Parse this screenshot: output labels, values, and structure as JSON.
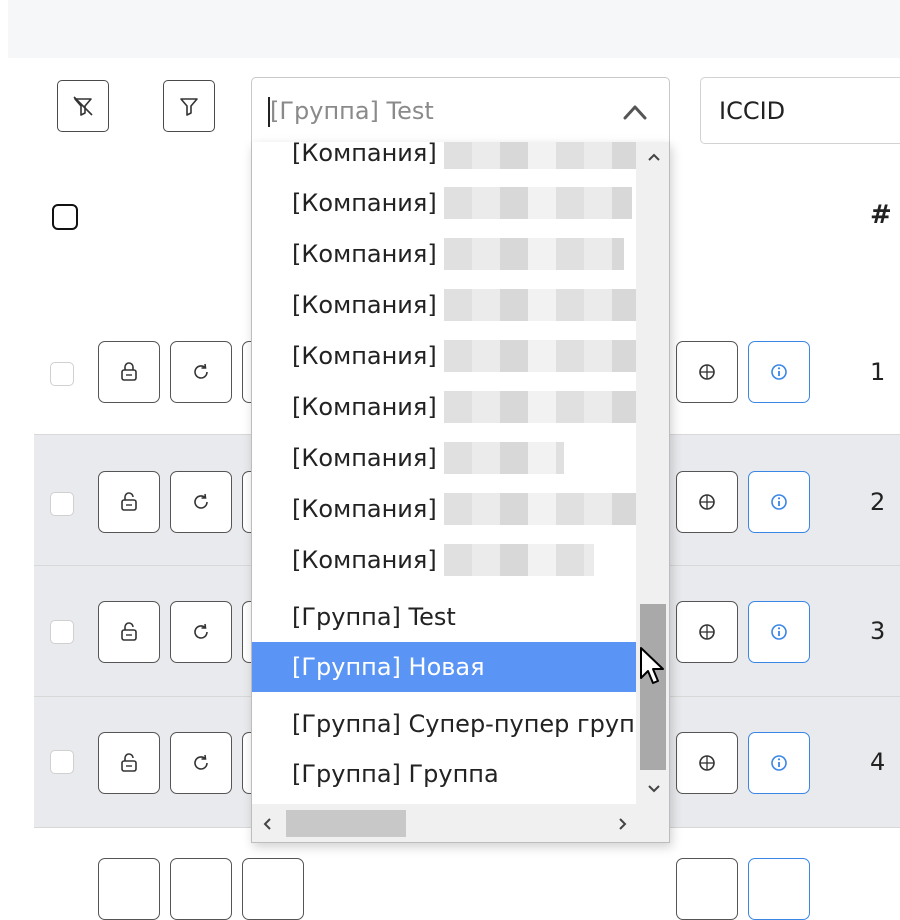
{
  "toolbar": {
    "clear_filters_icon": "filter-clear-icon",
    "filter_icon": "filter-icon"
  },
  "group_select": {
    "value": "[Группа] Test",
    "options": [
      "[Компания]",
      "[Компания]",
      "[Компания]",
      "[Компания]",
      "[Компания]",
      "[Компания]",
      "[Компания]",
      "[Компания]",
      "[Компания]",
      "[Группа] Test",
      "[Группа] Новая",
      "[Группа] Супер-пупер группа",
      "[Группа] Группа"
    ],
    "highlighted_option": "[Группа] Новая"
  },
  "iccid_field": {
    "value": "ICCID"
  },
  "table": {
    "number_header": "#",
    "rows": [
      {
        "num": "1",
        "locked": true
      },
      {
        "num": "2",
        "locked": false
      },
      {
        "num": "3",
        "locked": false
      },
      {
        "num": "4",
        "locked": false
      }
    ]
  },
  "colors": {
    "highlight": "#5a95f5",
    "info_border": "#3a86e6",
    "row_alt": "#e9eaed"
  }
}
